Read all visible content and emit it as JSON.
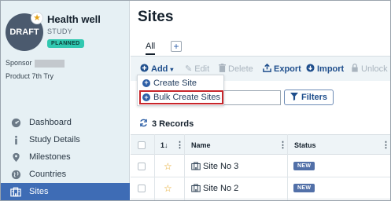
{
  "study": {
    "avatar_text": "DRAFT",
    "name": "Health well",
    "type": "STUDY",
    "status": "PLANNED",
    "sponsor_label": "Sponsor",
    "product_label": "Product",
    "product_value": "7th Try"
  },
  "nav": {
    "items": [
      {
        "label": "Dashboard",
        "icon": "dashboard-icon"
      },
      {
        "label": "Study Details",
        "icon": "info-icon"
      },
      {
        "label": "Milestones",
        "icon": "map-pin-icon"
      },
      {
        "label": "Countries",
        "icon": "globe-icon"
      },
      {
        "label": "Sites",
        "icon": "building-icon",
        "active": true
      }
    ]
  },
  "main": {
    "title": "Sites",
    "tabs": [
      {
        "label": "All"
      }
    ],
    "add_tab_symbol": "+"
  },
  "toolbar": {
    "add": "Add",
    "edit": "Edit",
    "delete": "Delete",
    "export": "Export",
    "import": "Import",
    "unlock": "Unlock"
  },
  "add_menu": {
    "items": [
      "Create Site",
      "Bulk Create Sites"
    ]
  },
  "search": {
    "value": ""
  },
  "filters_label": "Filters",
  "records_label": "3 Records",
  "table": {
    "sort_indicator": "1",
    "columns": [
      "Name",
      "Status"
    ],
    "rows": [
      {
        "name": "Site No 3",
        "status": "NEW"
      },
      {
        "name": "Site No 2",
        "status": "NEW"
      }
    ]
  },
  "colors": {
    "accent": "#3e6cb5",
    "sidebar_bg": "#e6f0f4",
    "status_planned": "#31c8b0",
    "badge_new": "#5270a8",
    "highlight": "#c8262b"
  }
}
